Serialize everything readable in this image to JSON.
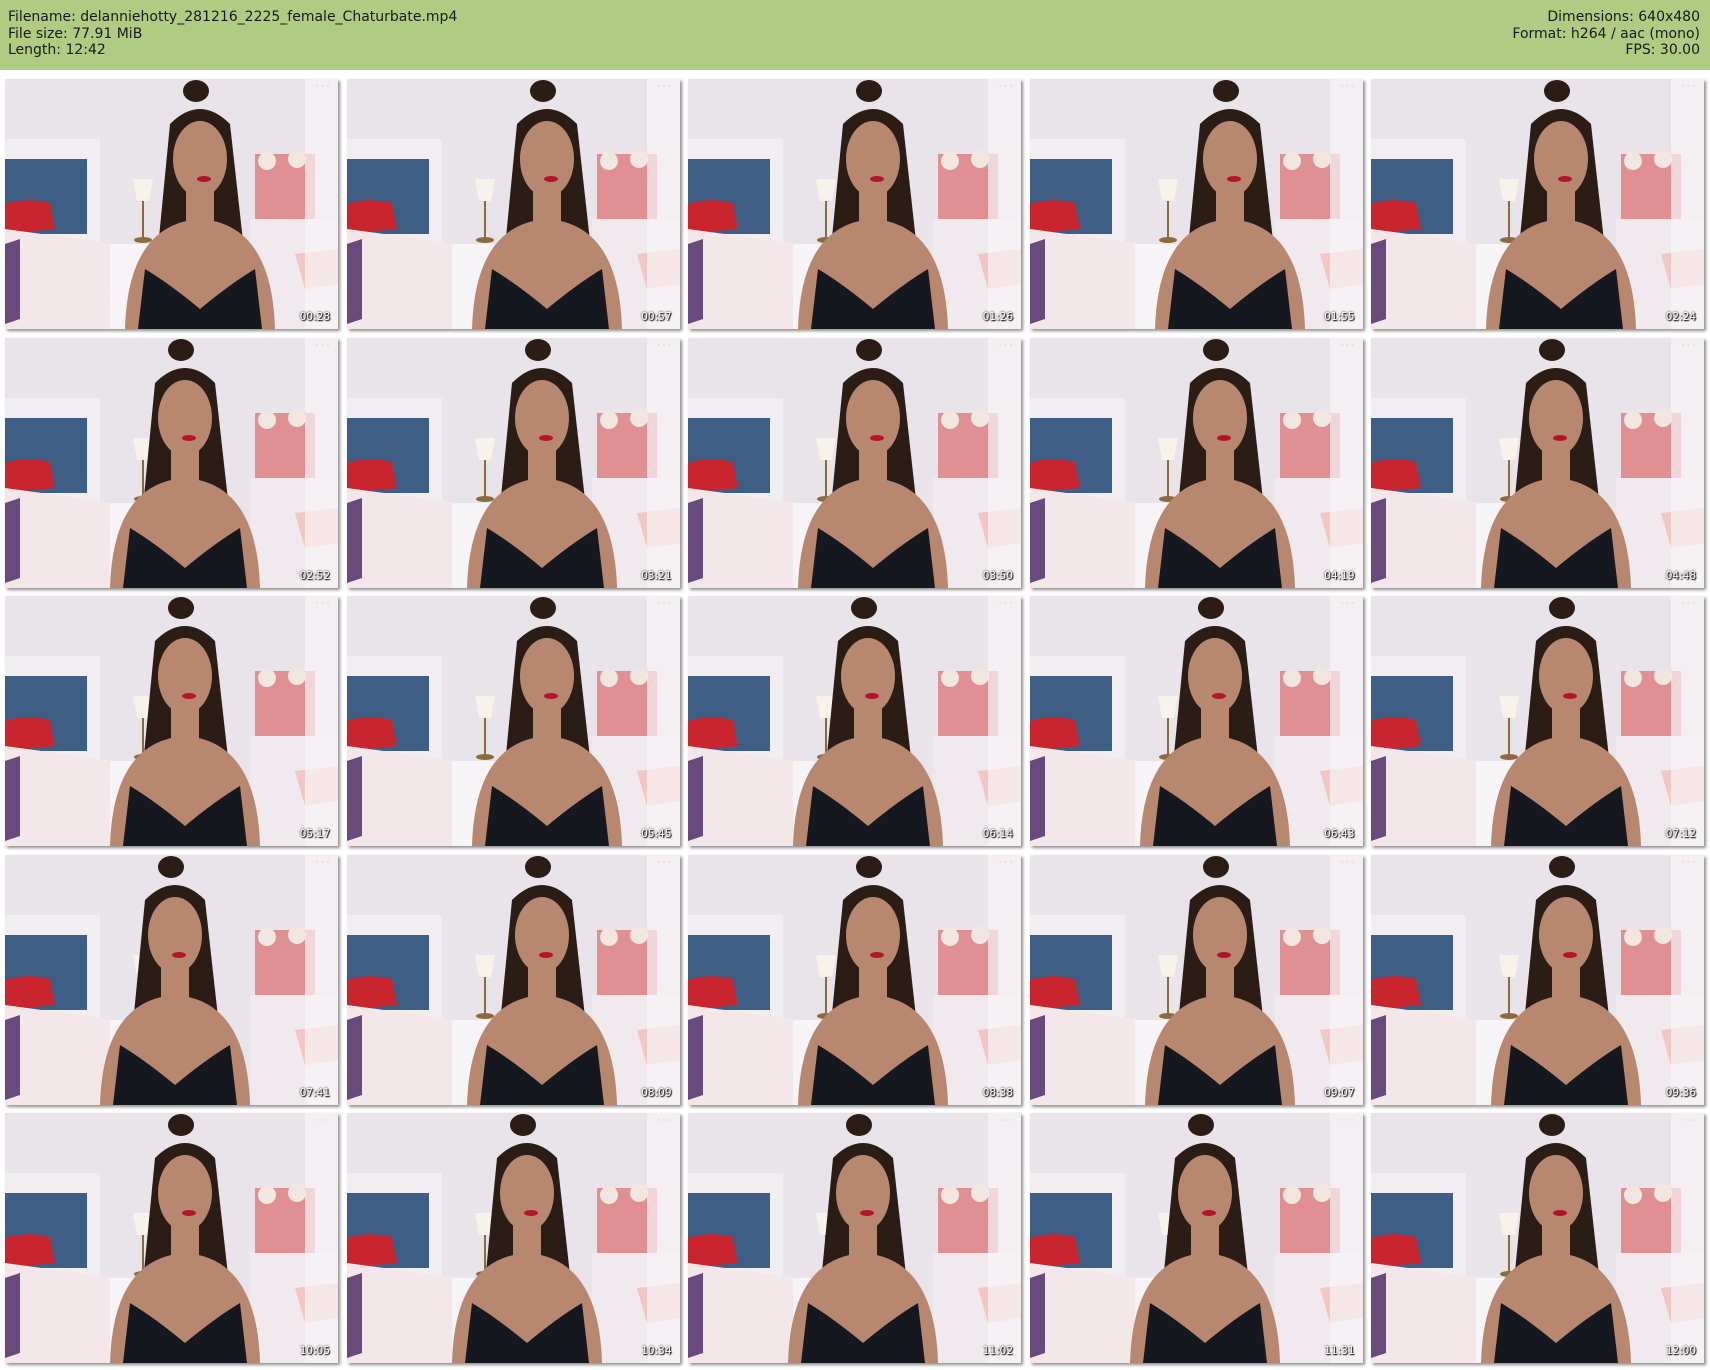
{
  "header": {
    "filename": "Filename: delanniehotty_281216_2225_female_Chaturbate.mp4",
    "file_size": "File size: 77.91 MiB",
    "length": "Length: 12:42",
    "dimensions": "Dimensions: 640x480",
    "format": "Format: h264 / aac (mono)",
    "fps": "FPS: 30.00"
  },
  "thumbnails": [
    "00:28",
    "00:57",
    "01:26",
    "01:55",
    "02:24",
    "02:52",
    "03:21",
    "03:50",
    "04:19",
    "04:48",
    "05:17",
    "05:45",
    "06:14",
    "06:43",
    "07:12",
    "07:41",
    "08:09",
    "08:38",
    "09:07",
    "09:36",
    "10:05",
    "10:34",
    "11:02",
    "11:31",
    "12:00"
  ],
  "colors": {
    "header_bg": "#b0cc82",
    "wall": "#e9e3ea",
    "headboard": "#3f5e86",
    "pillow": "#c8252f",
    "hair": "#2b1d16",
    "skin": "#b88770",
    "top": "#161820"
  }
}
